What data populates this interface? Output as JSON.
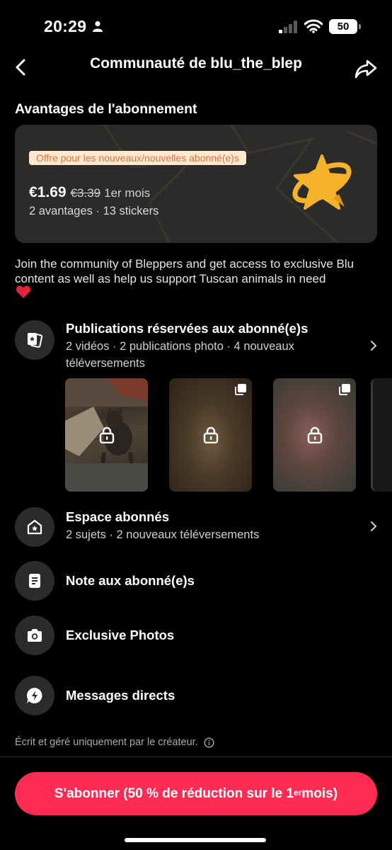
{
  "status_bar": {
    "time": "20:29",
    "battery": "50"
  },
  "header": {
    "title": "Communauté de blu_the_blep"
  },
  "section_title": "Avantages de l'abonnement",
  "offer": {
    "badge": "Offre pour les nouveaux/nouvelles abonné(e)s",
    "price": "€1.69",
    "old_price": "€3.39",
    "period": "1er mois",
    "summary": "2 avantages · 13 stickers"
  },
  "description": "Join the community of Bleppers and get access to exclusive Blu content as well as help us support Tuscan animals in need",
  "features": [
    {
      "title": "Publications réservées aux abonné(e)s",
      "subtitle": "2 vidéos · 2 publications photo · 4 nouveaux téléversements"
    },
    {
      "title": "Espace abonnés",
      "subtitle": "2 sujets · 2 nouveaux téléversements"
    },
    {
      "title": "Note aux abonné(e)s"
    },
    {
      "title": "Exclusive Photos"
    },
    {
      "title": "Messages directs"
    }
  ],
  "creator_note": "Écrit et géré uniquement par le créateur.",
  "subscribe": {
    "label": "S'abonner (50 % de réduction sur le 1",
    "sup": "er",
    "suffix": " mois)"
  },
  "colors": {
    "accent": "#fe2c55",
    "card_bg": "#2d2b29",
    "badge_bg": "#fde8d0",
    "badge_text": "#e36f3a",
    "star": "#f6b32a"
  }
}
